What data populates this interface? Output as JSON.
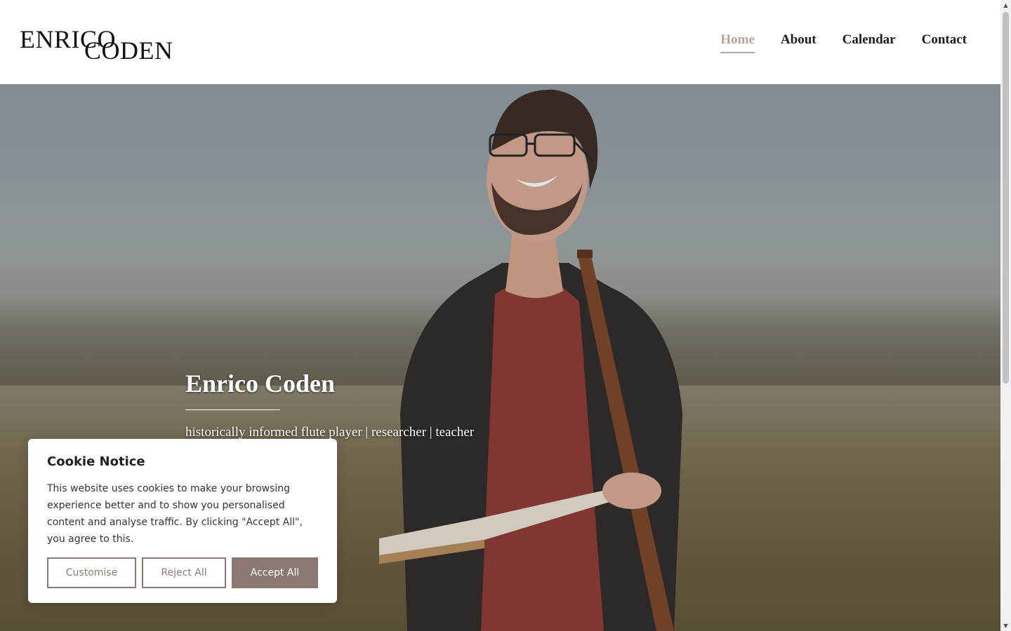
{
  "brand": {
    "line1": "ENRICO",
    "line2": "CODEN"
  },
  "nav": {
    "items": [
      {
        "label": "Home",
        "active": true
      },
      {
        "label": "About",
        "active": false
      },
      {
        "label": "Calendar",
        "active": false
      },
      {
        "label": "Contact",
        "active": false
      }
    ]
  },
  "hero": {
    "title": "Enrico Coden",
    "subtitle": "historically informed flute player | researcher | teacher"
  },
  "cookie": {
    "title": "Cookie Notice",
    "body": "This website uses cookies to make your browsing experience better and to show you personalised content and analyse traffic. By clicking \"Accept All\", you agree to this.",
    "customise_label": "Customise",
    "reject_label": "Reject All",
    "accept_label": "Accept All"
  },
  "colors": {
    "accent": "#8b7a73",
    "nav_active": "#b7a59b"
  },
  "scrollbar": {
    "up_icon": "▲",
    "down_icon": "▼"
  }
}
